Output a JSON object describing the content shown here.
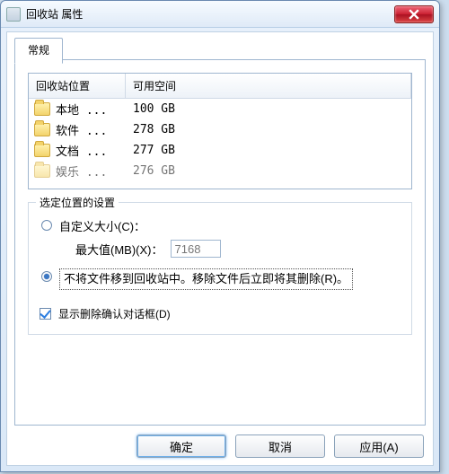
{
  "window": {
    "title": "回收站 属性"
  },
  "tabs": [
    {
      "label": "常规",
      "selected": true
    }
  ],
  "listview": {
    "headers": {
      "location": "回收站位置",
      "free": "可用空间"
    },
    "rows": [
      {
        "name": "本地 ...",
        "free": "100 GB"
      },
      {
        "name": "软件 ...",
        "free": "278 GB"
      },
      {
        "name": "文档 ...",
        "free": "277 GB"
      },
      {
        "name": "娱乐 ...",
        "free": "276 GB"
      }
    ]
  },
  "group": {
    "title": "选定位置的设置",
    "option_custom": "自定义大小(C)：",
    "max_label": "最大值(MB)(X)：",
    "max_value": "7168",
    "option_nomove": "不将文件移到回收站中。移除文件后立即将其删除(R)。",
    "selected": "nomove"
  },
  "checkbox": {
    "label": "显示删除确认对话框(D)",
    "checked": true
  },
  "buttons": {
    "ok": "确定",
    "cancel": "取消",
    "apply": "应用(A)"
  }
}
